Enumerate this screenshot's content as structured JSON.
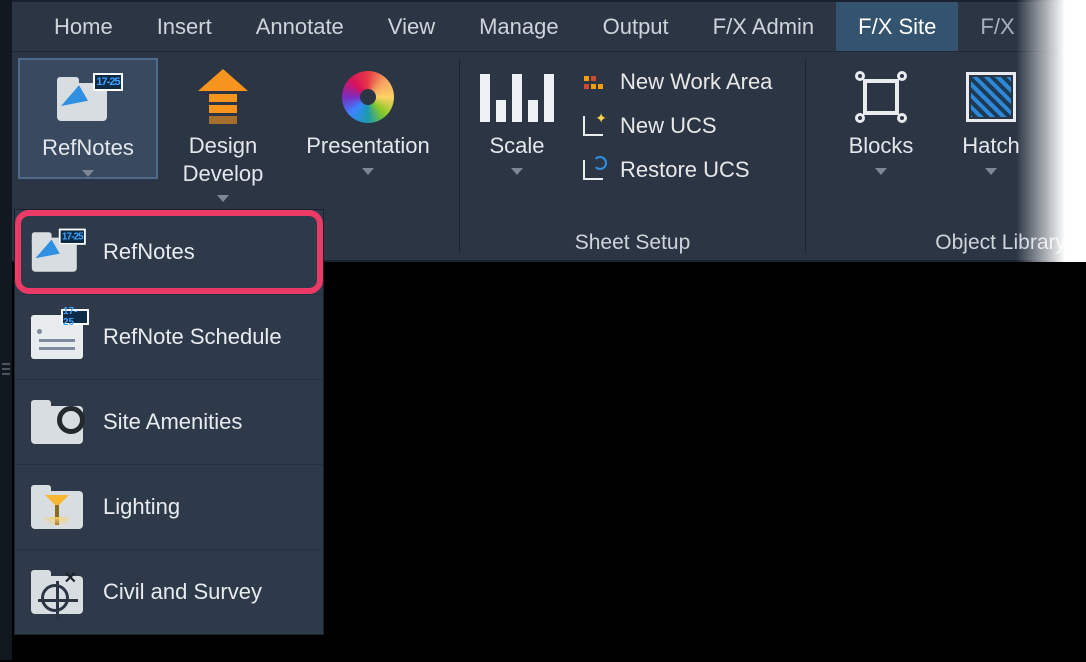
{
  "tabs": {
    "items": [
      "Home",
      "Insert",
      "Annotate",
      "View",
      "Manage",
      "Output",
      "F/X Admin",
      "F/X Site",
      "F/X"
    ],
    "active_index": 7
  },
  "ribbon": {
    "refnotes": {
      "label": "RefNotes"
    },
    "design": {
      "label": "Design\nDevelop"
    },
    "presentation": {
      "label": "Presentation"
    },
    "scale": {
      "label": "Scale"
    },
    "sheet": {
      "title": "Sheet Setup",
      "new_work_area": "New Work Area",
      "new_ucs": "New UCS",
      "restore_ucs": "Restore UCS"
    },
    "blocks": {
      "label": "Blocks"
    },
    "hatch": {
      "label": "Hatch"
    },
    "objlib_title": "Object Library"
  },
  "dropdown": {
    "refnotes": "RefNotes",
    "refnote_schedule": "RefNote Schedule",
    "site_amenities": "Site  Amenities",
    "lighting": "Lighting",
    "civil": "Civil and Survey"
  },
  "icon_tag": "17-25"
}
